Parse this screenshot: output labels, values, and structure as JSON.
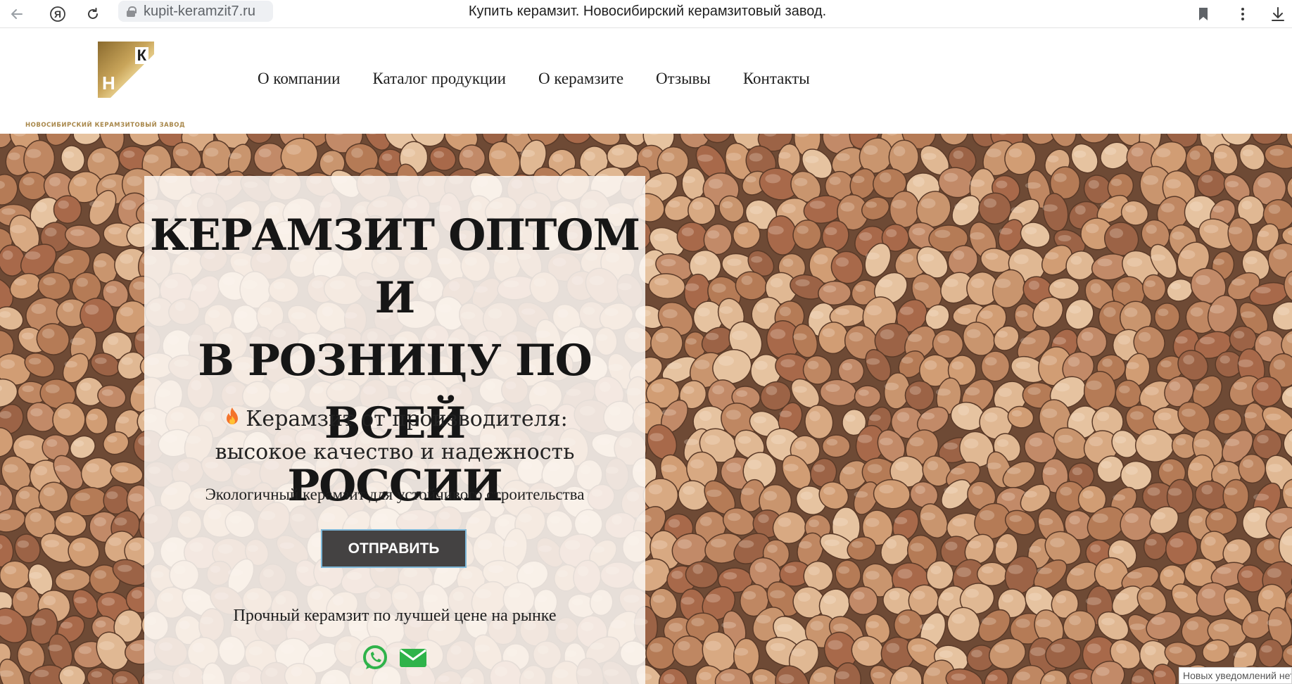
{
  "browser": {
    "url": "kupit-keramzit7.ru",
    "tab_title": "Купить керамзит. Новосибирский керамзитовый завод.",
    "icons": [
      "back-arrow-icon",
      "yandex-icon",
      "reload-icon",
      "lock-icon",
      "bookmark-icon",
      "more-vertical-icon",
      "download-icon"
    ]
  },
  "header": {
    "logo": {
      "letters": [
        "К",
        "Н"
      ],
      "caption": "НОВОСИБИРСКИЙ КЕРАМЗИТОВЫЙ ЗАВОД",
      "color_gold": "#c9a55a"
    },
    "nav": [
      {
        "label": "О компании"
      },
      {
        "label": "Каталог продукции"
      },
      {
        "label": "О керамзите"
      },
      {
        "label": "Отзывы"
      },
      {
        "label": "Контакты"
      }
    ]
  },
  "hero": {
    "title_lines": [
      "КЕРАМЗИТ ОПТОМ И",
      "В РОЗНИЦУ ПО ВСЕЙ",
      "РОССИИ"
    ],
    "subtitle_lines": [
      "Керамзит от производителя:",
      "высокое качество и надежность"
    ],
    "eco_text": "Экологичный керамзит для устойчивого строительства",
    "button_label": "ОТПРАВИТЬ",
    "price_text": "Прочный керамзит по лучшей цене на рынке",
    "contact_icons": [
      "whatsapp-icon",
      "email-icon"
    ],
    "colors": {
      "button_bg": "#444242",
      "button_border": "#7db7d8",
      "whatsapp": "#2fb34a",
      "email": "#2fb34a"
    }
  },
  "notification": {
    "text": "Новых уведомлений нет"
  }
}
